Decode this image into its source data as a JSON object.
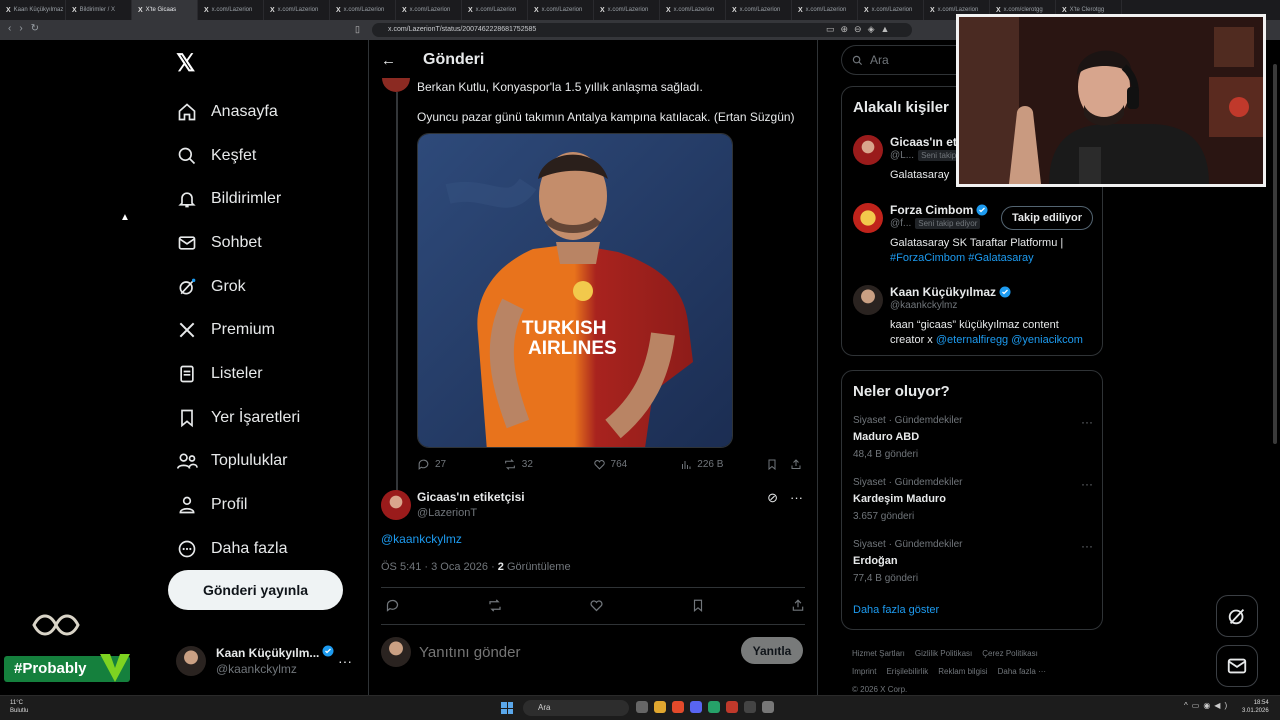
{
  "browser": {
    "tabs": [
      "Kaan Küçükyılmaz",
      "Bildirimler / X",
      "X'te Gicaas",
      "x.com/Lazerion",
      "x.com/Lazerion",
      "x.com/Lazerion",
      "x.com/Lazerion",
      "x.com/Lazerion",
      "x.com/Lazerion",
      "x.com/Lazerion",
      "x.com/Lazerion",
      "x.com/Lazerion",
      "x.com/Lazerion",
      "x.com/Lazerion",
      "x.com/Lazerion",
      "x.com/clerotgg",
      "X'te Clerotgg"
    ],
    "active_tab": 2,
    "url": "x.com/LazerionT/status/2007462228681752585"
  },
  "nav": {
    "items": [
      {
        "label": "Anasayfa",
        "icon": "home-icon"
      },
      {
        "label": "Keşfet",
        "icon": "search-icon"
      },
      {
        "label": "Bildirimler",
        "icon": "bell-icon"
      },
      {
        "label": "Sohbet",
        "icon": "mail-icon"
      },
      {
        "label": "Grok",
        "icon": "grok-icon"
      },
      {
        "label": "Premium",
        "icon": "x-icon"
      },
      {
        "label": "Listeler",
        "icon": "list-icon"
      },
      {
        "label": "Yer İşaretleri",
        "icon": "bookmark-icon"
      },
      {
        "label": "Topluluklar",
        "icon": "people-icon"
      },
      {
        "label": "Profil",
        "icon": "person-icon"
      },
      {
        "label": "Daha fazla",
        "icon": "more-circle-icon"
      }
    ],
    "post_button": "Gönderi yayınla",
    "account": {
      "name": "Kaan Küçükyılm...",
      "handle": "@kaankckylmz"
    }
  },
  "overlay": {
    "tag": "#Probably"
  },
  "post": {
    "header_title": "Gönderi",
    "quoted_line1": "Berkan Kutlu, Konyaspor'la 1.5 yıllık anlaşma sağladı.",
    "quoted_line2": "Oyuncu pazar günü takımın Antalya kampına katılacak. (Ertan Süzgün)",
    "stats": {
      "replies": "27",
      "reposts": "32",
      "likes": "764",
      "views": "226 B"
    },
    "reply": {
      "author_name": "Gicaas'ın etiketçisi",
      "author_handle": "@LazerionT",
      "text": "@kaankckylmz",
      "timestamp": "ÖS 5:41 · 3 Oca 2026 · ",
      "view_count": "2",
      "view_label": " Görüntüleme"
    },
    "compose_placeholder": "Yanıtını gönder",
    "compose_button": "Yanıtla"
  },
  "right": {
    "search_placeholder": "Ara",
    "relevant_title": "Alakalı kişiler",
    "people": [
      {
        "name": "Gicaas'ın eti",
        "handle": "@L...",
        "follows_you": "Seni takip",
        "bio": "Galatasaray"
      },
      {
        "name": "Forza Cimbom",
        "handle": "@f...",
        "follows_you": "Seni takip ediyor",
        "button": "Takip ediliyor",
        "bio": "Galatasaray SK Taraftar Platformu |",
        "bio_links": "#ForzaCimbom #Galatasaray"
      },
      {
        "name": "Kaan Küçükyılmaz",
        "handle": "@kaankckylmz",
        "bio": "kaan “gicaas” küçükyılmaz content creator x",
        "bio_links": "@eternalfiregg @yeniacikcom"
      }
    ],
    "trends_title": "Neler oluyor?",
    "trends": [
      {
        "meta": "Siyaset · Gündemdekiler",
        "title": "Maduro ABD",
        "count": "48,4 B gönderi"
      },
      {
        "meta": "Siyaset · Gündemdekiler",
        "title": "Kardeşim Maduro",
        "count": "3.657 gönderi"
      },
      {
        "meta": "Siyaset · Gündemdekiler",
        "title": "Erdoğan",
        "count": "77,4 B gönderi"
      }
    ],
    "show_more": "Daha fazla göster",
    "footer": [
      "Hizmet Şartları",
      "Gizlilik Politikası",
      "Çerez Politikası",
      "Imprint",
      "Erişilebilirlik",
      "Reklam bilgisi",
      "Daha fazla ···",
      "© 2026 X Corp."
    ]
  },
  "taskbar": {
    "weather_temp": "11°C",
    "weather_desc": "Bulutlu",
    "search": "Ara",
    "time": "18:54",
    "date": "3.01.2026"
  },
  "colors": {
    "accent": "#1d9bf0",
    "background": "#000000",
    "border": "#2f3336",
    "muted": "#71767b",
    "overlay_green": "#15803d",
    "galatasaray_orange": "#e8731c",
    "galatasaray_red": "#a8231e"
  }
}
